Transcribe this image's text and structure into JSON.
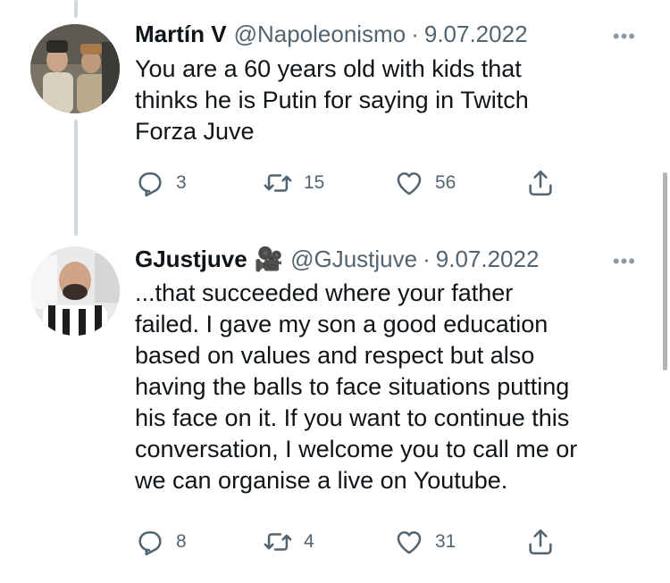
{
  "tweets": [
    {
      "display_name": "Martín V",
      "handle": "@Napoleonismo",
      "separator": "·",
      "date": "9.07.2022",
      "more": "•••",
      "lines": [
        "You are a 60 years old with kids that",
        "thinks he is Putin for saying in Twitch",
        "Forza Juve"
      ],
      "replies": "3",
      "retweets": "15",
      "likes": "56"
    },
    {
      "display_name": "GJustjuve",
      "name_emoji": "🎥",
      "handle": "@GJustjuve",
      "separator": "·",
      "date": "9.07.2022",
      "more": "•••",
      "lines": [
        "...that succeeded where your father",
        "failed. I gave my son a good education",
        "based on values and respect but also",
        "having the balls to face situations putting",
        "his face on it. If you want to continue this",
        "conversation, I welcome you to call me or",
        "we can organise a live on Youtube."
      ],
      "replies": "8",
      "retweets": "4",
      "likes": "31"
    }
  ],
  "icons": {
    "reply": "reply-icon",
    "retweet": "retweet-icon",
    "like": "heart-icon",
    "share": "share-icon"
  },
  "colors": {
    "text": "#0f1419",
    "secondary": "#536471",
    "thread_line": "#cfd9de"
  }
}
